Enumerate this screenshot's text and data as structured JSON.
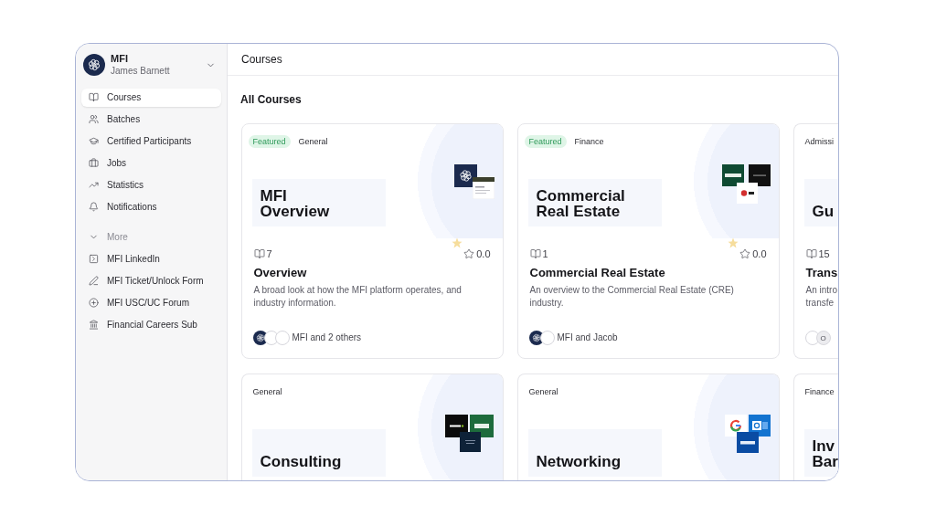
{
  "org_switcher": {
    "name": "MFI",
    "user": "James Barnett"
  },
  "sidebar": {
    "items": [
      {
        "label": "Courses",
        "selected": true
      },
      {
        "label": "Batches",
        "selected": false
      },
      {
        "label": "Certified Participants",
        "selected": false
      },
      {
        "label": "Jobs",
        "selected": false
      },
      {
        "label": "Statistics",
        "selected": false
      },
      {
        "label": "Notifications",
        "selected": false
      }
    ],
    "more": {
      "label": "More",
      "expanded": true,
      "items": [
        {
          "label": "MFI LinkedIn"
        },
        {
          "label": "MFI Ticket/Unlock Form"
        },
        {
          "label": "MFI USC/UC Forum"
        },
        {
          "label": "Financial Careers Sub"
        }
      ]
    }
  },
  "header": {
    "title": "Courses"
  },
  "section": {
    "title": "All Courses"
  },
  "courses": [
    {
      "tags": [
        {
          "kind": "featured",
          "label": "Featured"
        },
        {
          "kind": "category",
          "label": "General"
        }
      ],
      "thumbnail_title": "MFI\nOverview",
      "lessons": "7",
      "rating": "0.0",
      "title": "Overview",
      "description": "A broad look at how the MFI platform operates, and industry information.",
      "avatars": [
        {
          "kind": "logo"
        },
        {
          "kind": "blank"
        },
        {
          "kind": "blank"
        }
      ],
      "instructors": "MFI and 2 others"
    },
    {
      "tags": [
        {
          "kind": "featured",
          "label": "Featured"
        },
        {
          "kind": "category",
          "label": "Finance"
        }
      ],
      "thumbnail_title": "Commercial\nReal Estate",
      "lessons": "1",
      "rating": "0.0",
      "title": "Commercial Real Estate",
      "description": "An overview to the Commercial Real Estate (CRE) industry.",
      "avatars": [
        {
          "kind": "logo"
        },
        {
          "kind": "blank"
        }
      ],
      "instructors": "MFI and Jacob"
    },
    {
      "tags": [
        {
          "kind": "category",
          "label": "Admissi"
        }
      ],
      "thumbnail_title": "Gu",
      "lessons": "15",
      "title": "Trans",
      "description": "An intro transfe",
      "avatars": [
        {
          "kind": "blank"
        },
        {
          "kind": "initial",
          "initial": "O"
        }
      ]
    },
    {
      "tags": [
        {
          "kind": "category",
          "label": "General"
        }
      ],
      "thumbnail_title": "Consulting"
    },
    {
      "tags": [
        {
          "kind": "category",
          "label": "General"
        }
      ],
      "thumbnail_title": "Networking"
    },
    {
      "tags": [
        {
          "kind": "category",
          "label": "Finance"
        }
      ],
      "thumbnail_title": "Inv\nBar"
    }
  ]
}
